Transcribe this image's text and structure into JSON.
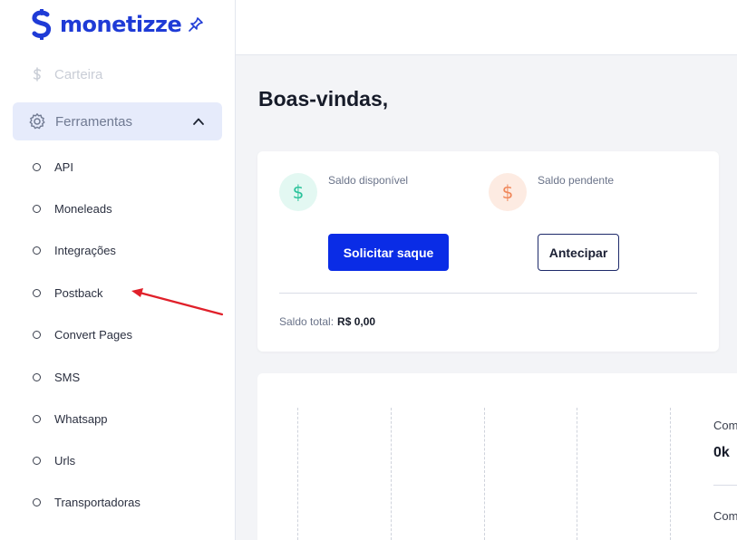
{
  "brand": {
    "name": "monetizze",
    "color": "#1f3bd6"
  },
  "sidebar": {
    "wallet_label": "Carteira",
    "tools_label": "Ferramentas",
    "tools_icon": "gear-icon",
    "items": [
      {
        "label": "API"
      },
      {
        "label": "Moneleads"
      },
      {
        "label": "Integrações"
      },
      {
        "label": "Postback"
      },
      {
        "label": "Convert Pages"
      },
      {
        "label": "SMS"
      },
      {
        "label": "Whatsapp"
      },
      {
        "label": "Urls"
      },
      {
        "label": "Transportadoras"
      }
    ]
  },
  "main": {
    "welcome": "Boas-vindas,",
    "balance": {
      "available_label": "Saldo disponível",
      "pending_label": "Saldo pendente",
      "withdraw_button": "Solicitar saque",
      "advance_button": "Antecipar",
      "total_label": "Saldo total:",
      "total_value": "R$ 0,00",
      "currency_symbol": "$"
    },
    "chart_panel": {
      "label_1": "Com",
      "value_1": "0k",
      "label_2": "Com"
    }
  },
  "colors": {
    "primary": "#0a2ce6",
    "available_badge": "#29c29a",
    "pending_badge": "#f0875a",
    "active_menu_bg": "#e6ebfb",
    "annotation_arrow": "#e0202a"
  }
}
